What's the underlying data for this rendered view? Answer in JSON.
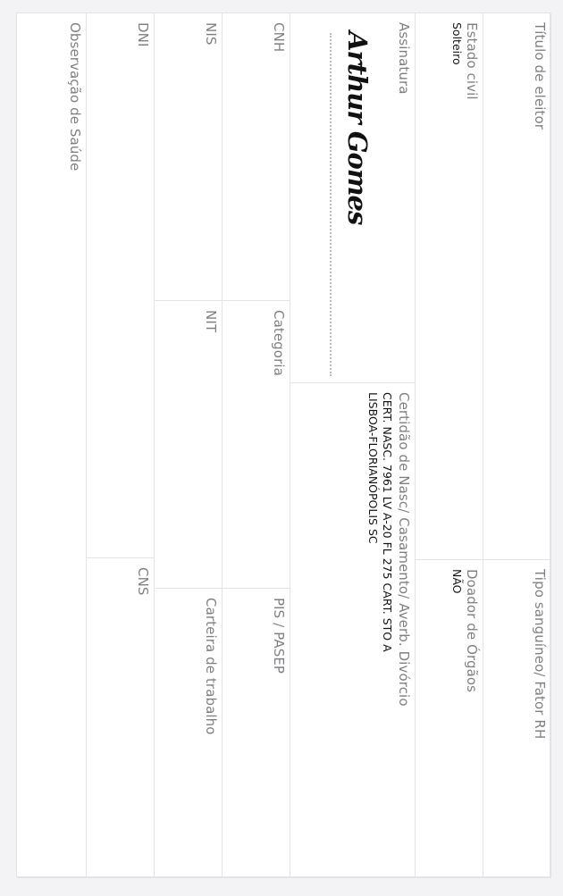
{
  "form": {
    "titulo_eleitor": {
      "label": "Título de eleitor",
      "value": ""
    },
    "tipo_sanguineo": {
      "label": "Tipo sanguíneo/ Fator RH",
      "value": ""
    },
    "estado_civil": {
      "label": "Estado civil",
      "value": "Solteiro"
    },
    "doador_orgaos": {
      "label": "Doador de Órgãos",
      "value": "NÃO"
    },
    "assinatura": {
      "label": "Assinatura",
      "signature": "Arthur Gomes"
    },
    "certidao": {
      "label": "Certidão de Nasc/ Casamento/ Averb. Divórcio",
      "value_line1": "CERT. NASC. 7961 LV A-20 FL 275 CART. STO A",
      "value_line2": "LISBOA-FLORIANÓPOLIS SC"
    },
    "cnh": {
      "label": "CNH",
      "value": ""
    },
    "categoria": {
      "label": "Categoria",
      "value": ""
    },
    "pis_pasep": {
      "label": "PIS / PASEP",
      "value": ""
    },
    "nis": {
      "label": "NIS",
      "value": ""
    },
    "nit": {
      "label": "NIT",
      "value": ""
    },
    "carteira_trabalho": {
      "label": "Carteira de trabalho",
      "value": ""
    },
    "dni": {
      "label": "DNI",
      "value": ""
    },
    "cns": {
      "label": "CNS",
      "value": ""
    },
    "observacao_saude": {
      "label": "Observação de Saúde",
      "value": ""
    }
  }
}
